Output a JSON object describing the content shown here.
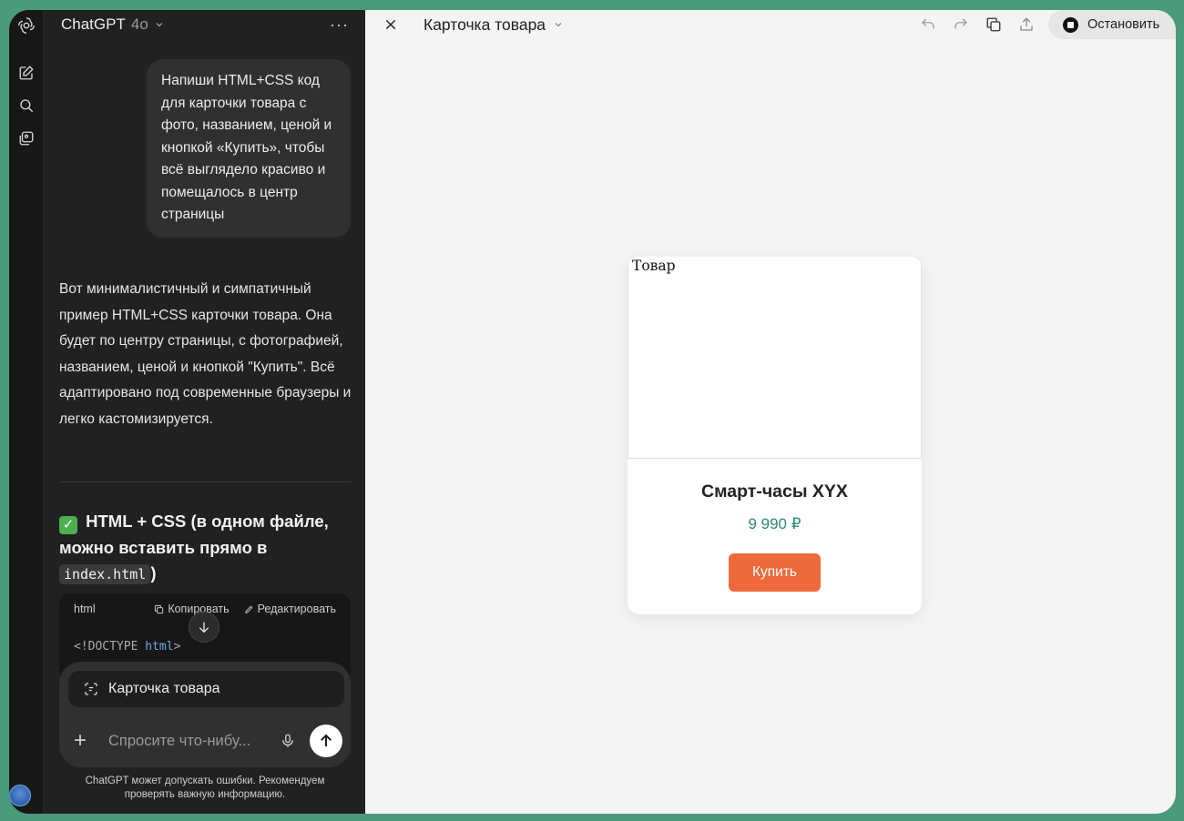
{
  "sidebar": {
    "model_name": "ChatGPT",
    "model_version": "4o",
    "more_label": "···"
  },
  "chat": {
    "user_message": "Напиши HTML+CSS код для карточки товара с фото, названием, ценой и кнопкой «Купить», чтобы всё выглядело красиво и помещалось в центр страницы",
    "assistant_message": "Вот минималистичный и симпатичный пример HTML+CSS карточки товара. Она будет по центру страницы, с фотографией, названием, ценой и кнопкой \"Купить\". Всё адаптировано под современные браузеры и легко кастомизируется.",
    "heading_emoji": "✓",
    "heading_text": "HTML + CSS (в одном файле, можно вставить прямо в",
    "heading_code": "index.html",
    "heading_tail": ")",
    "code_lang": "html",
    "copy_label": "Копировать",
    "edit_label": "Редактировать",
    "code_line_prefix": "<!DOCTYPE ",
    "code_line_kw": "html",
    "code_line_suffix": ">"
  },
  "composer": {
    "canvas_chip_label": "Карточка товара",
    "placeholder": "Спросите что-нибу...",
    "disclaimer": "ChatGPT может допускать ошибки. Рекомендуем проверять важную информацию."
  },
  "canvas": {
    "title": "Карточка товара",
    "stop_label": "Остановить",
    "card": {
      "image_alt": "Товар",
      "product_name": "Смарт-часы XYX",
      "price": "9 990 ₽",
      "buy_label": "Купить"
    }
  },
  "colors": {
    "accent_button": "#ee6a3c",
    "price_color": "#2e8b6f",
    "frame_background": "#4a9a7c"
  }
}
